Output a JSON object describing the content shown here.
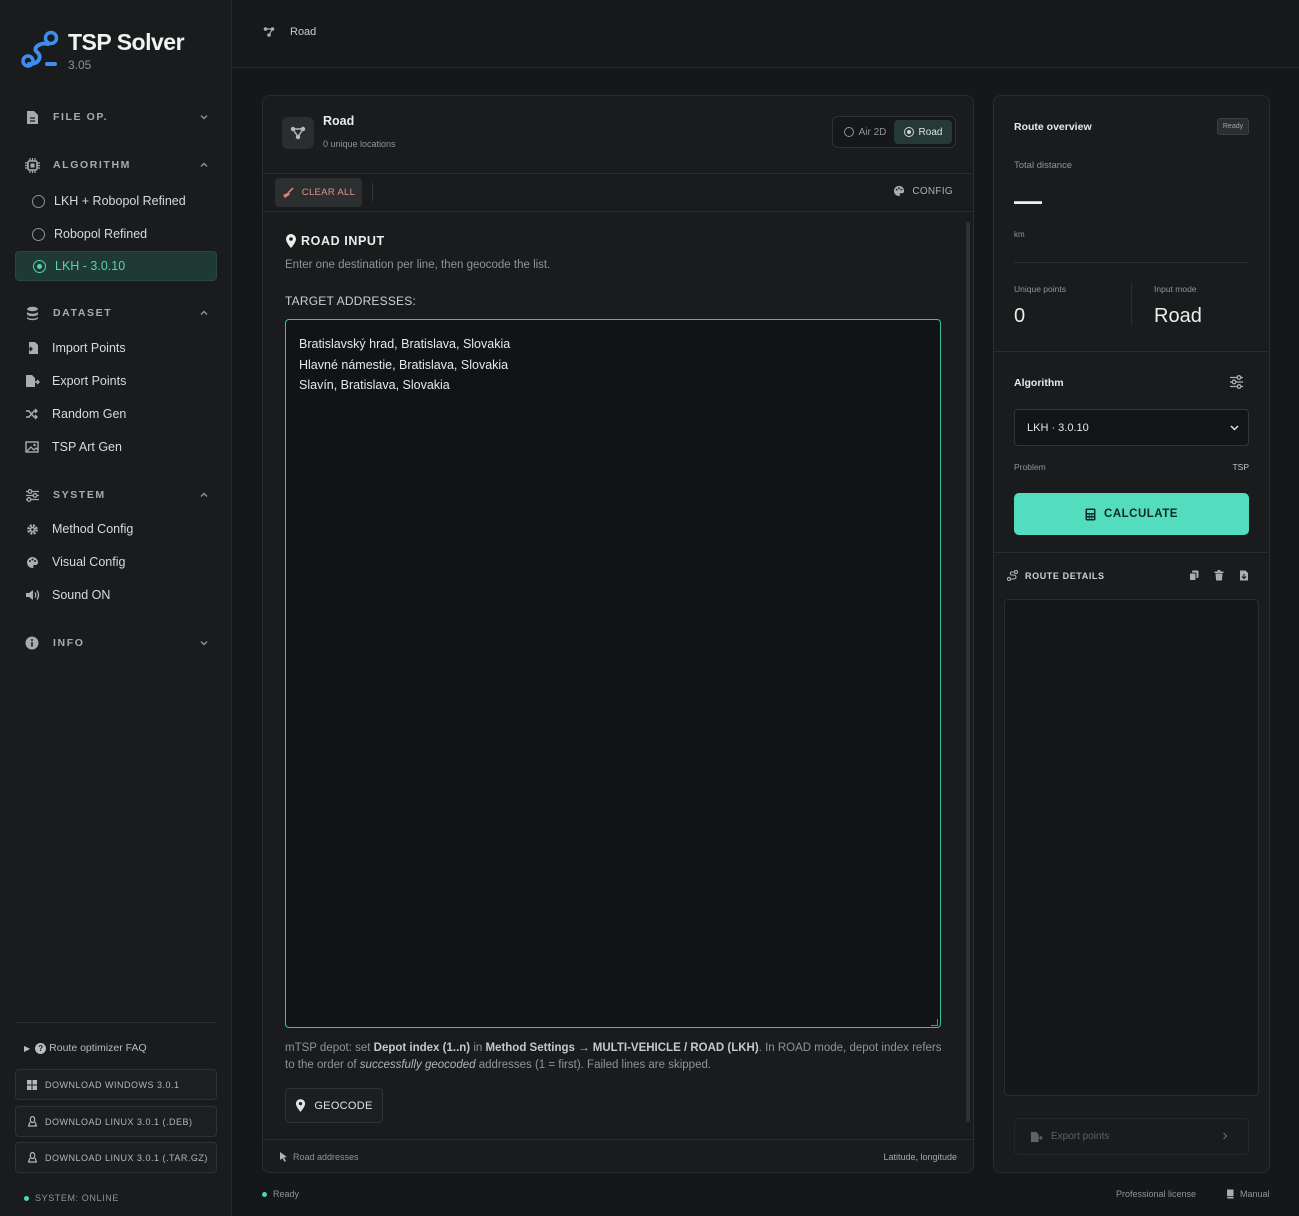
{
  "app": {
    "title": "TSP Solver",
    "version": "3.05",
    "accent_color": "#4fd4b5"
  },
  "sidebar": {
    "sections": {
      "file": {
        "label": "FILE OP.",
        "icon": "file-icon",
        "expanded": false
      },
      "algorithm": {
        "label": "ALGORITHM",
        "icon": "chip-icon",
        "expanded": true
      },
      "dataset": {
        "label": "DATASET",
        "icon": "database-icon",
        "expanded": true
      },
      "system": {
        "label": "SYSTEM",
        "icon": "sliders-icon",
        "expanded": true
      },
      "info": {
        "label": "INFO",
        "icon": "info-icon",
        "expanded": false
      }
    },
    "algorithms": [
      {
        "label": "LKH + Robopol Refined",
        "selected": false
      },
      {
        "label": "Robopol Refined",
        "selected": false
      },
      {
        "label": "LKH - 3.0.10",
        "selected": true
      }
    ],
    "dataset_items": [
      {
        "label": "Import Points",
        "icon": "import-icon"
      },
      {
        "label": "Export Points",
        "icon": "export-icon"
      },
      {
        "label": "Random Gen",
        "icon": "shuffle-icon"
      },
      {
        "label": "TSP Art Gen",
        "icon": "image-icon"
      }
    ],
    "system_items": [
      {
        "label": "Method Config",
        "icon": "gear-icon"
      },
      {
        "label": "Visual Config",
        "icon": "palette-icon"
      },
      {
        "label": "Sound ON",
        "icon": "speaker-icon"
      }
    ],
    "faq": "Route optimizer FAQ",
    "downloads": [
      {
        "label": "DOWNLOAD WINDOWS 3.0.1",
        "icon": "windows-icon"
      },
      {
        "label": "DOWNLOAD LINUX 3.0.1 (.DEB)",
        "icon": "linux-icon"
      },
      {
        "label": "DOWNLOAD LINUX 3.0.1 (.TAR.GZ)",
        "icon": "linux-icon"
      }
    ],
    "system_status": "SYSTEM: ONLINE"
  },
  "topbar": {
    "breadcrumb": "Road"
  },
  "main": {
    "title": "Road",
    "subtitle": "0 unique locations",
    "modes": [
      {
        "label": "Air 2D",
        "active": false
      },
      {
        "label": "Road",
        "active": true
      }
    ],
    "toolbar": {
      "clear_label": "CLEAR ALL",
      "config_label": "CONFIG"
    },
    "road_input": {
      "title": "ROAD INPUT",
      "description": "Enter one destination per line, then geocode the list.",
      "addresses_label": "TARGET ADDRESSES:",
      "addresses": "Bratislavský hrad, Bratislava, Slovakia\nHlavné námestie, Bratislava, Slovakia\nSlavín, Bratislava, Slovakia",
      "note_parts": {
        "p1": "mTSP depot: set ",
        "b1": "Depot index (1..n)",
        "p2": " in ",
        "b2": "Method Settings → MULTI-VEHICLE / ROAD (LKH)",
        "p3": ". In ROAD mode, depot index refers to the order of ",
        "i1": "successfully geocoded",
        "p4": " addresses (1 = first). Failed lines are skipped."
      },
      "geocode_label": "GEOCODE"
    },
    "footer": {
      "left": "Road addresses",
      "right": "Latitude, longitude"
    }
  },
  "overview": {
    "title": "Route overview",
    "badge": "Ready",
    "total_distance_label": "Total distance",
    "total_distance_value": "—",
    "unit": "km",
    "unique_points_label": "Unique points",
    "unique_points_value": "0",
    "input_mode_label": "Input mode",
    "input_mode_value": "Road",
    "algorithm_title": "Algorithm",
    "algorithm_selected": "LKH · 3.0.10",
    "problem_label": "Problem",
    "problem_value": "TSP",
    "calculate_label": "CALCULATE",
    "route_details_title": "ROUTE DETAILS",
    "export_label": "Export points"
  },
  "statusbar": {
    "status": "Ready",
    "license": "Professional license",
    "manual": "Manual"
  }
}
